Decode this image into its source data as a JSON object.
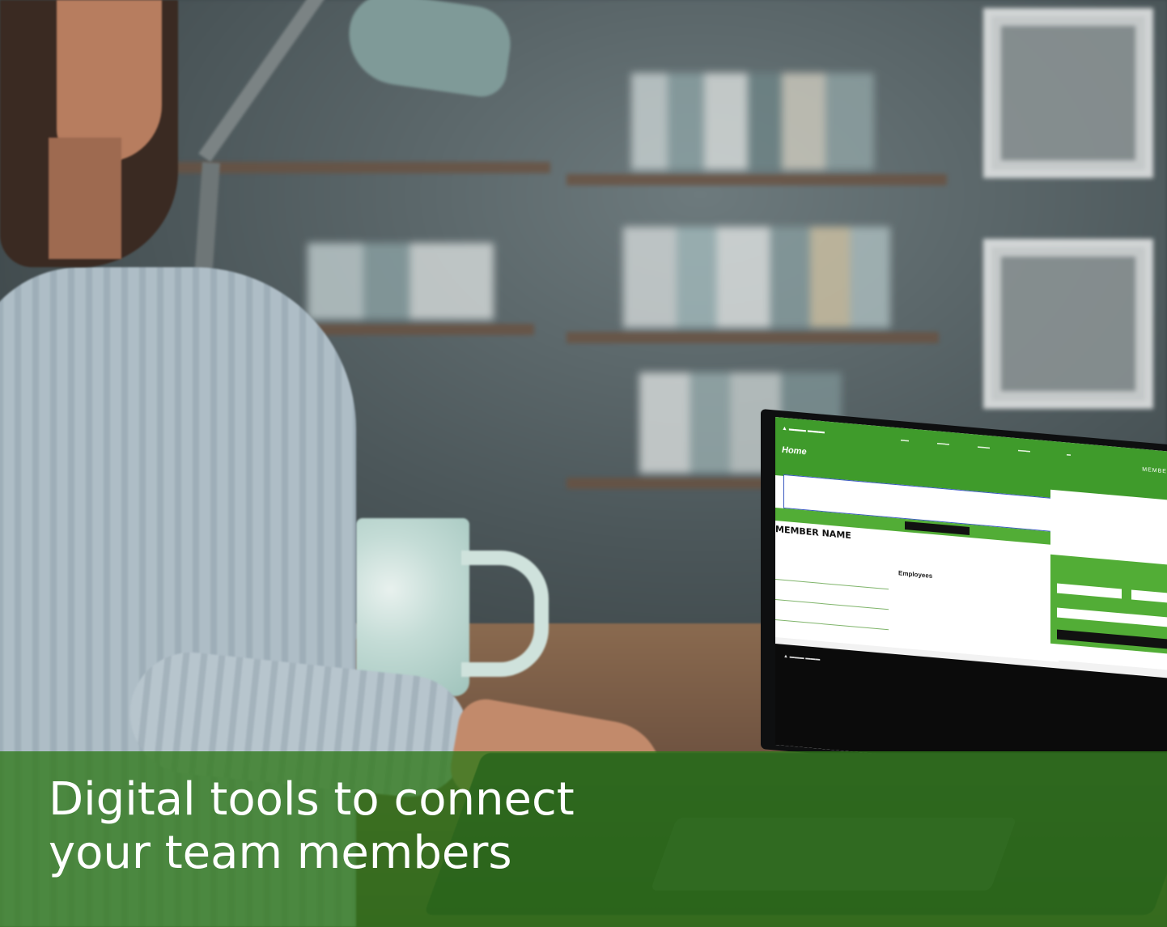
{
  "headline": {
    "line1": "Digital tools to connect",
    "line2": "your team members"
  },
  "laptop_screen": {
    "page_title": "Home",
    "member_label": "MEMBER NAME",
    "employees_label": "Employees",
    "member_badge": "MEMBER"
  },
  "colors": {
    "band": "#30781A",
    "brand_green": "#3F9B2B",
    "text": "#FFFFFF"
  }
}
